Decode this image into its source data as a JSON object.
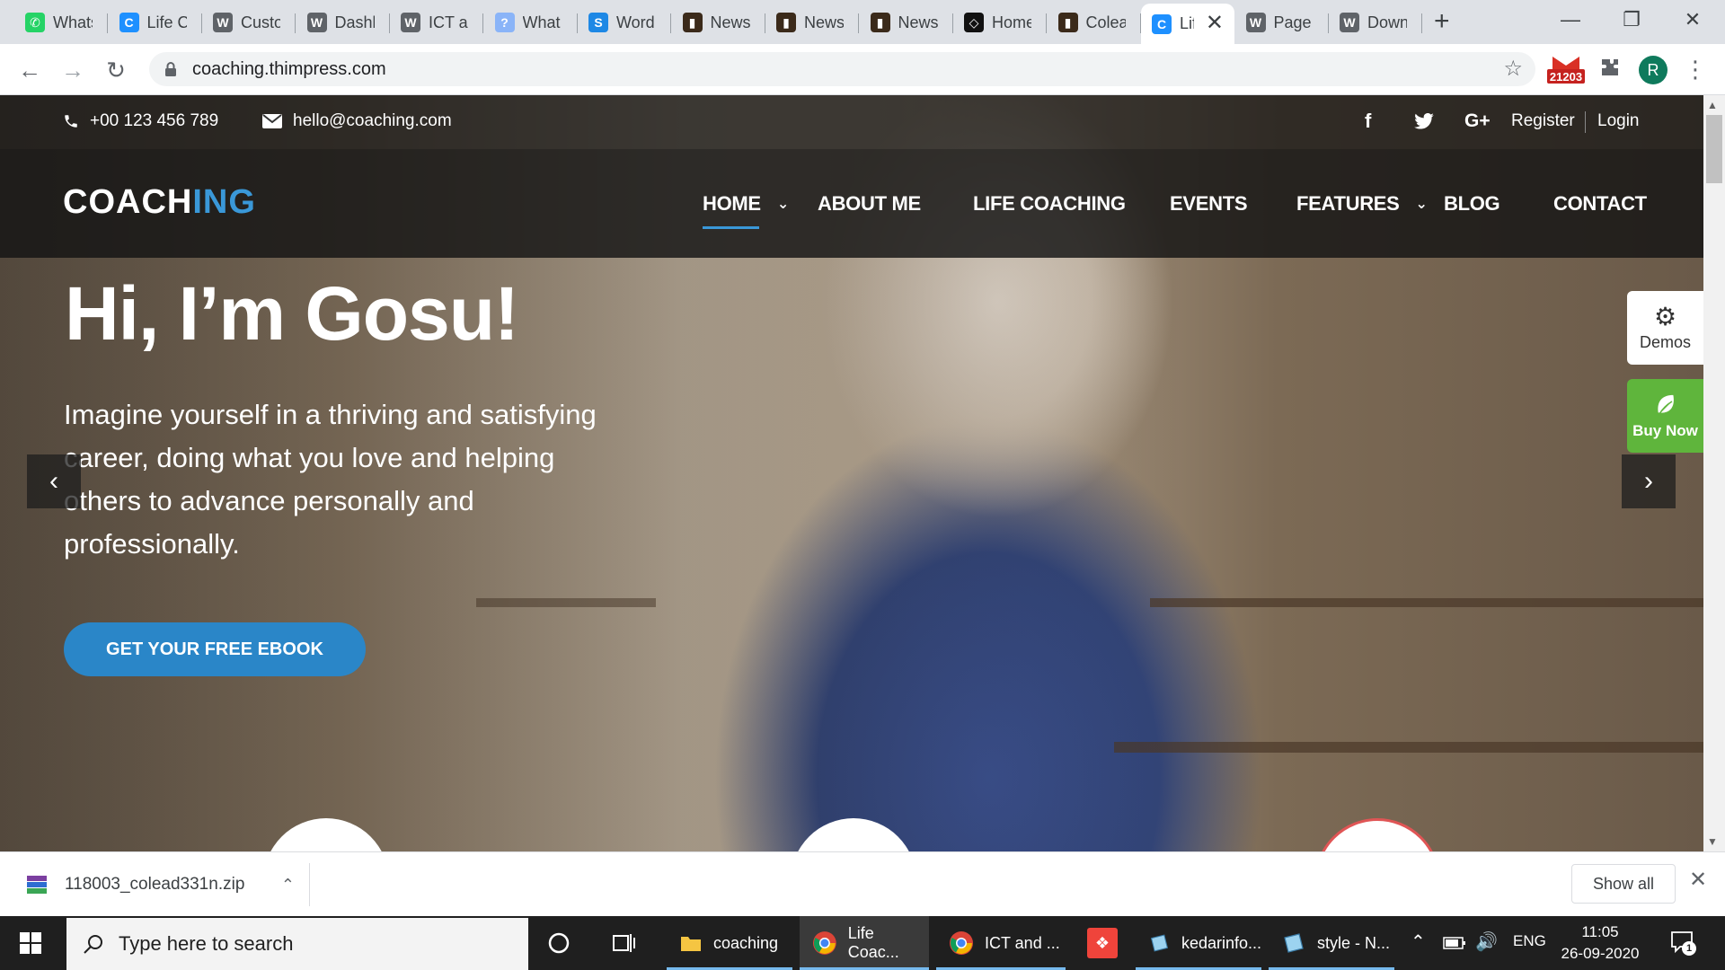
{
  "browser": {
    "tabs": [
      {
        "label": "WhatsApp",
        "icon": "whatsapp-icon",
        "color": "#25d366",
        "glyph": "✆"
      },
      {
        "label": "Life Coaching",
        "icon": "coaching-favicon-icon",
        "color": "#1e90ff",
        "glyph": "C"
      },
      {
        "label": "Customize",
        "icon": "wordpress-icon",
        "color": "#5f6368",
        "glyph": "W"
      },
      {
        "label": "Dashboard",
        "icon": "wordpress-icon",
        "color": "#5f6368",
        "glyph": "W"
      },
      {
        "label": "ICT and",
        "icon": "wordpress-icon",
        "color": "#5f6368",
        "glyph": "W"
      },
      {
        "label": "What",
        "icon": "search-page-icon",
        "color": "#8ab4f8",
        "glyph": "?"
      },
      {
        "label": "WordPress",
        "icon": "s-icon",
        "color": "#1e88e5",
        "glyph": "S"
      },
      {
        "label": "News",
        "icon": "theme-thumb-icon",
        "color": "#3b2a1a",
        "glyph": "▮"
      },
      {
        "label": "News",
        "icon": "theme-thumb-icon",
        "color": "#3b2a1a",
        "glyph": "▮"
      },
      {
        "label": "News",
        "icon": "theme-thumb-icon",
        "color": "#3b2a1a",
        "glyph": "▮"
      },
      {
        "label": "Home",
        "icon": "envato-icon",
        "color": "#111111",
        "glyph": "◇"
      },
      {
        "label": "Colead",
        "icon": "theme-thumb-icon",
        "color": "#3b2a1a",
        "glyph": "▮"
      },
      {
        "label": "Life Coaching",
        "icon": "coaching-favicon-icon",
        "color": "#1e90ff",
        "glyph": "C",
        "active": true
      },
      {
        "label": "Page",
        "icon": "wordpress-icon",
        "color": "#5f6368",
        "glyph": "W"
      },
      {
        "label": "Download",
        "icon": "wordpress-icon",
        "color": "#5f6368",
        "glyph": "W"
      }
    ],
    "url": "coaching.thimpress.com",
    "extension_badge": "21203",
    "profile_initial": "R"
  },
  "site": {
    "phone": "+00 123 456 789",
    "email": "hello@coaching.com",
    "register": "Register",
    "login": "Login",
    "logo_main": "COACH",
    "logo_accent": "ING",
    "nav": [
      "HOME",
      "ABOUT ME",
      "LIFE COACHING",
      "EVENTS",
      "FEATURES",
      "BLOG",
      "CONTACT"
    ],
    "hero_title": "Hi, I’m Gosu!",
    "hero_text": "Imagine yourself in a thriving and satisfying career, doing what you love and helping others to advance personally and professionally.",
    "cta": "GET YOUR FREE EBOOK",
    "demos": "Demos",
    "buy_now": "Buy Now",
    "colors": {
      "accent": "#3a98d8",
      "cta": "#2a86c8",
      "buy_now": "#5fb53c"
    }
  },
  "downloads": {
    "file": "118003_colead331n.zip",
    "show_all": "Show all"
  },
  "taskbar": {
    "search_placeholder": "Type here to search",
    "apps": [
      "coaching",
      "Life Coac...",
      "ICT and ...",
      "kedarinfo...",
      "style - N..."
    ],
    "lang": "ENG",
    "time": "11:05",
    "date": "26-09-2020",
    "notif_count": "1"
  }
}
